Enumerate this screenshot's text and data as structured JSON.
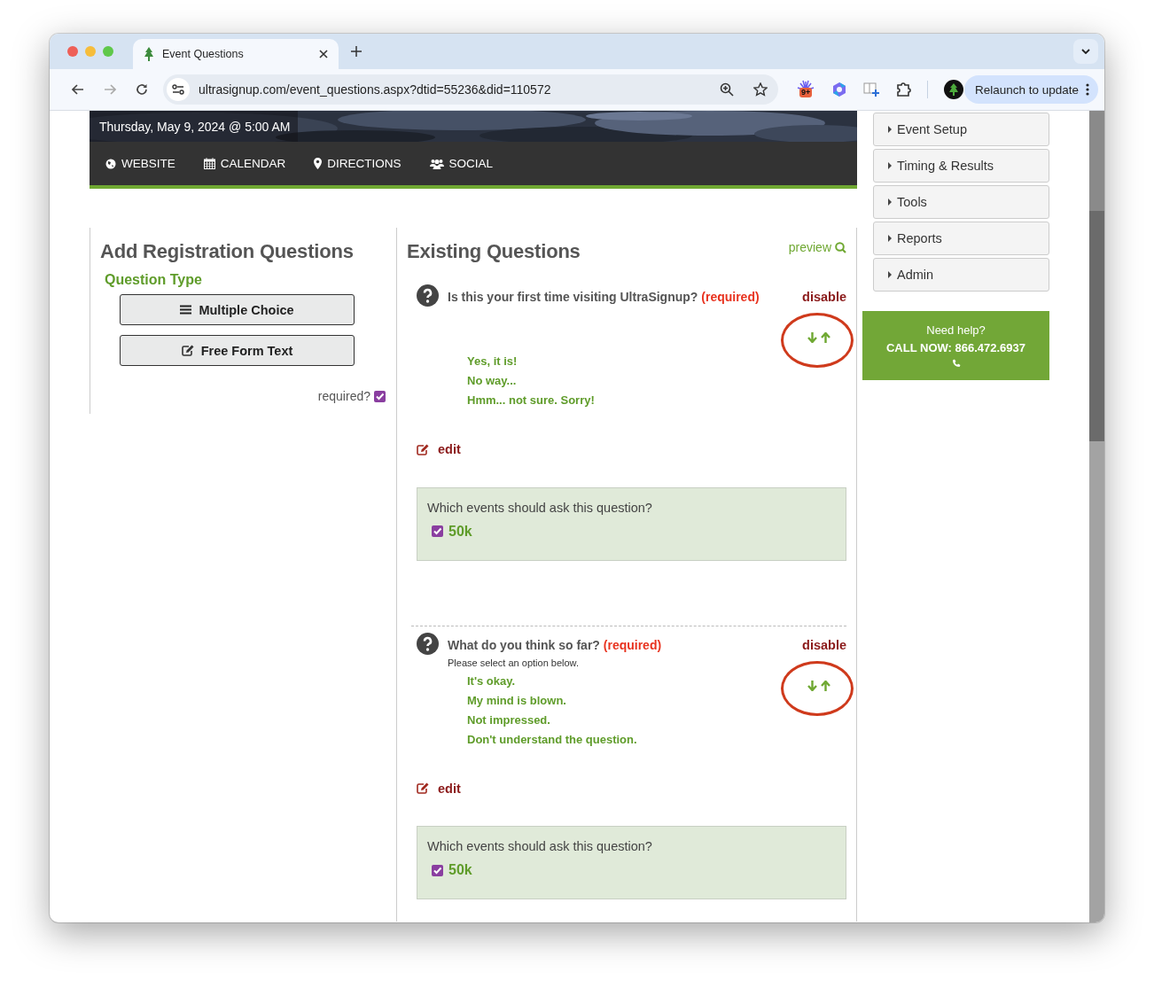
{
  "browser": {
    "tab": {
      "title": "Event Questions"
    },
    "url": "ultrasignup.com/event_questions.aspx?dtid=55236&did=110572",
    "extension_badge": "9+",
    "relaunch": "Relaunch to update"
  },
  "event": {
    "date": "Thursday, May 9, 2024 @ 5:00 AM",
    "nav": [
      {
        "label": "WEBSITE",
        "kind": "globe"
      },
      {
        "label": "CALENDAR",
        "kind": "calendar"
      },
      {
        "label": "DIRECTIONS",
        "kind": "pin"
      },
      {
        "label": "SOCIAL",
        "kind": "people"
      }
    ]
  },
  "add_panel": {
    "title": "Add Registration Questions",
    "subtitle": "Question Type",
    "buttons": [
      {
        "label": "Multiple Choice",
        "kind": "list"
      },
      {
        "label": "Free Form Text",
        "kind": "edit"
      }
    ],
    "required": {
      "label": "required?",
      "checked": true
    }
  },
  "existing": {
    "title": "Existing Questions",
    "preview": "preview",
    "questions": [
      {
        "text": "Is this your first time visiting UltraSignup?",
        "required_label": "(required)",
        "action": "disable",
        "reorder_circled": true,
        "options": [
          "Yes, it is!",
          "No way...",
          "Hmm... not sure. Sorry!"
        ],
        "edit": "edit",
        "events": {
          "prompt": "Which events should ask this question?",
          "items": [
            {
              "label": "50k",
              "checked": true
            }
          ]
        }
      },
      {
        "text": "What do you think so far?",
        "required_label": "(required)",
        "action": "disable",
        "hint": "Please select an option below.",
        "reorder_circled": true,
        "options": [
          "It's okay.",
          "My mind is blown.",
          "Not impressed.",
          "Don't understand the question."
        ],
        "edit": "edit",
        "events": {
          "prompt": "Which events should ask this question?",
          "items": [
            {
              "label": "50k",
              "checked": true
            }
          ]
        }
      }
    ]
  },
  "sidebar": {
    "menu": [
      "Event Setup",
      "Timing & Results",
      "Tools",
      "Reports",
      "Admin"
    ],
    "help": {
      "title": "Need help?",
      "phone": "CALL NOW: 866.472.6937"
    }
  }
}
